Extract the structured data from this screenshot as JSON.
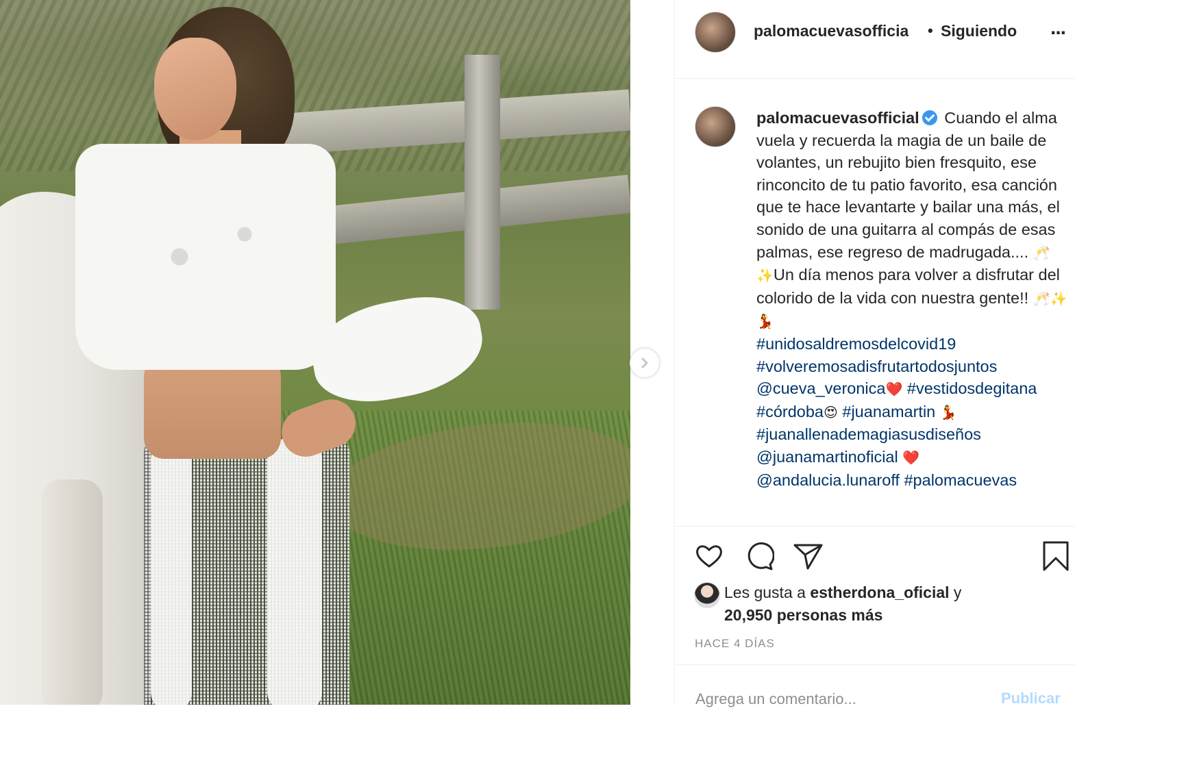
{
  "post": {
    "username": "palomacuevasofficial",
    "username_truncated": "palomacuevasofficia",
    "separator": "•",
    "follow_label": "Siguiendo",
    "more_label": "...",
    "caption_parts": {
      "username": "palomacuevasofficial",
      "text": "Cuando el alma vuela y recuerda la magia de un baile de volantes, un rebujito bien fresquito, ese rinconcito de tu patio favorito, esa canción que te hace levantarte y bailar una más, el sonido de una guitarra al compás de esas palmas, ese regreso de madrugada....",
      "emoji_1": "🥂✨",
      "text_2": "Un día menos para volver a disfrutar del colorido de la vida con nuestra gente!! ",
      "emoji_2": "🥂✨💃",
      "tag_1": "#unidosaldremosdelcovid19",
      "tag_2": "#volveremosadisfrutartodosjuntos",
      "mention_1": "@cueva_veronica",
      "emoji_heart_1": "❤️",
      "tag_3": "#vestidosdegitana",
      "tag_4": "#córdoba",
      "emoji_hearteyes": "😍",
      "tag_5": "#juanamartin",
      "emoji_dancer": "💃",
      "tag_6": "#juanallenademagiasusdiseños",
      "mention_2": "@juanamartinoficial",
      "emoji_heart_2": "❤️",
      "mention_3": "@andalucia.lunaroff",
      "tag_7": "#palomacuevas"
    },
    "likes": {
      "prefix": "Les gusta a ",
      "liker": "esther​dona_oficial",
      "conj": " y",
      "count_text": "20,950 personas más"
    },
    "timestamp": "HACE 4 DÍAS",
    "comment_placeholder": "Agrega un comentario...",
    "publish_label": "Publicar"
  },
  "colors": {
    "link": "#003569",
    "verified": "#3897f0",
    "muted": "#8e8e8e",
    "publish_disabled": "#b3dbff"
  },
  "icons": [
    "heart-icon",
    "comment-icon",
    "share-icon",
    "bookmark-icon",
    "chevron-right-icon",
    "more-icon",
    "verified-icon"
  ]
}
